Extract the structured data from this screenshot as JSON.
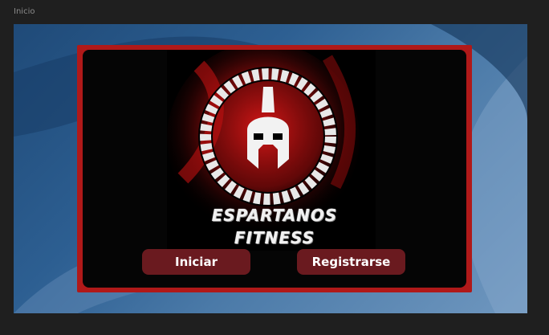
{
  "window": {
    "title": "Inicio"
  },
  "logo": {
    "icon": "spartan-helmet-icon",
    "line1": "ESPARTANOS",
    "line2": "FITNESS"
  },
  "buttons": {
    "login_label": "Iniciar",
    "register_label": "Registrarse"
  },
  "colors": {
    "card_border": "#b01919",
    "button_bg": "#6a1a1f",
    "card_bg": "#050505"
  }
}
